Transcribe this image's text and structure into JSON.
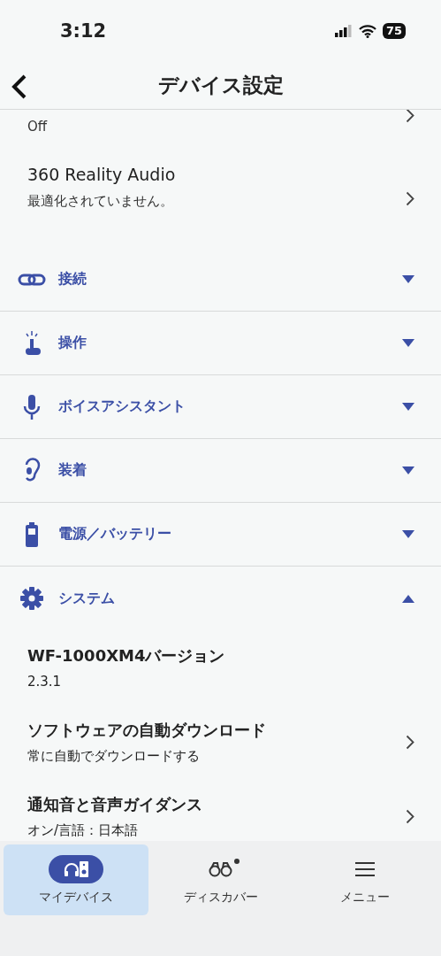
{
  "status_bar": {
    "time": "3:12",
    "battery": "75"
  },
  "header": {
    "title": "デバイス設定"
  },
  "top_rows": [
    {
      "subtitle": "Off"
    },
    {
      "title": "360 Reality Audio",
      "subtitle": "最適化されていません。"
    }
  ],
  "sections": [
    {
      "label": "接続",
      "kind": "link",
      "expanded": false
    },
    {
      "label": "操作",
      "kind": "tap",
      "expanded": false
    },
    {
      "label": "ボイスアシスタント",
      "kind": "mic",
      "expanded": false
    },
    {
      "label": "装着",
      "kind": "ear",
      "expanded": false
    },
    {
      "label": "電源／バッテリー",
      "kind": "battery",
      "expanded": false
    },
    {
      "label": "システム",
      "kind": "gear",
      "expanded": true
    }
  ],
  "system_items": [
    {
      "kind": "info",
      "title": "WF-1000XM4バージョン",
      "subtitle": "2.3.1"
    },
    {
      "kind": "link",
      "title": "ソフトウェアの自動ダウンロード",
      "subtitle": "常に自動でダウンロードする"
    },
    {
      "kind": "link",
      "title": "通知音と音声ガイダンス",
      "subtitle": "オン/言語：日本語"
    }
  ],
  "nav": [
    {
      "label": "マイデバイス",
      "kind": "device",
      "selected": true,
      "badge": false
    },
    {
      "label": "ディスカバー",
      "kind": "binoculars",
      "selected": false,
      "badge": true
    },
    {
      "label": "メニュー",
      "kind": "menu",
      "selected": false,
      "badge": false
    }
  ]
}
